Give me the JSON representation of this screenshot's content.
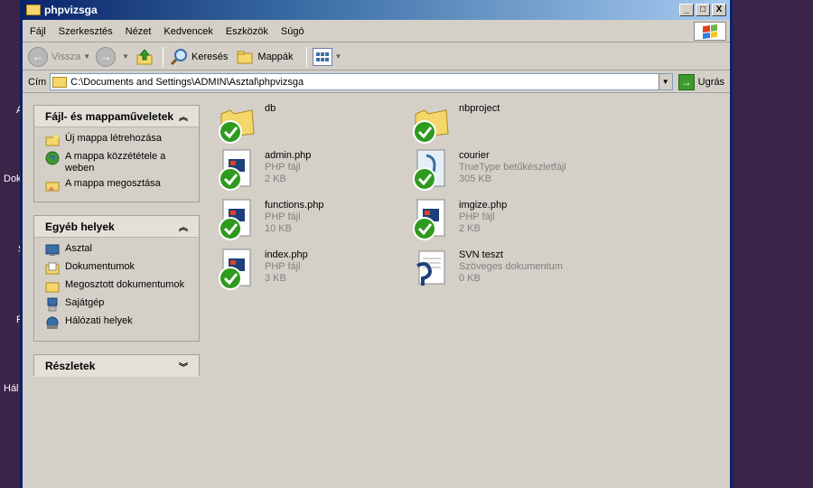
{
  "window": {
    "title": "phpvizsga"
  },
  "titlebar_buttons": {
    "minimize": "_",
    "maximize": "□",
    "close": "X"
  },
  "menu": [
    "Fájl",
    "Szerkesztés",
    "Nézet",
    "Kedvencek",
    "Eszközök",
    "Súgó"
  ],
  "toolbar": {
    "back_label": "Vissza",
    "search_label": "Keresés",
    "folders_label": "Mappák"
  },
  "address": {
    "label": "Cím",
    "value": "C:\\Documents and Settings\\ADMIN\\Asztal\\phpvizsga",
    "go_label": "Ugrás"
  },
  "panels": {
    "tasks": {
      "title": "Fájl- és mappaműveletek",
      "items": [
        "Új mappa létrehozása",
        "A mappa közzététele a weben",
        "A mappa megosztása"
      ]
    },
    "places": {
      "title": "Egyéb helyek",
      "items": [
        "Asztal",
        "Dokumentumok",
        "Megosztott dokumentumok",
        "Sajátgép",
        "Hálózati helyek"
      ]
    },
    "details": {
      "title": "Részletek"
    }
  },
  "files": [
    {
      "name": "db",
      "type": "",
      "size": ""
    },
    {
      "name": "nbproject",
      "type": "",
      "size": ""
    },
    {
      "name": "admin.php",
      "type": "PHP fájl",
      "size": "2 KB"
    },
    {
      "name": "courier",
      "type": "TrueType betűkészletfájl",
      "size": "305 KB"
    },
    {
      "name": "functions.php",
      "type": "PHP fájl",
      "size": "10 KB"
    },
    {
      "name": "imgize.php",
      "type": "PHP fájl",
      "size": "2 KB"
    },
    {
      "name": "index.php",
      "type": "PHP fájl",
      "size": "3 KB"
    },
    {
      "name": "SVN teszt",
      "type": "Szöveges dokumentum",
      "size": "0 KB"
    }
  ],
  "desktop_labels": [
    "A",
    "Dok",
    "S",
    "P",
    "Hál"
  ],
  "colors": {
    "titlebar": "#0a246a",
    "check": "#2e9a1e",
    "folder": "#f5d66a"
  }
}
